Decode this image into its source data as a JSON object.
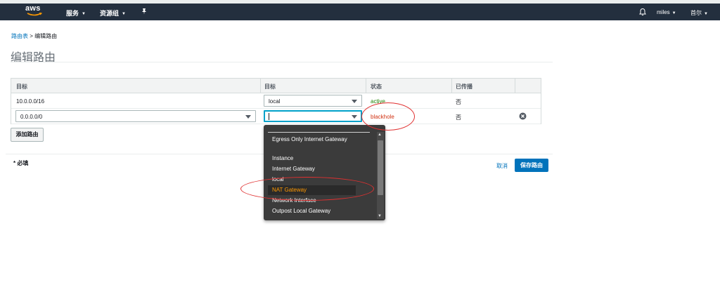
{
  "navbar": {
    "logo_text": "aws",
    "services_label": "服务",
    "resource_groups_label": "资源组",
    "user_label": "miles",
    "region_label": "首尔"
  },
  "breadcrumb": {
    "parent": "路由表",
    "separator": " > ",
    "current": "编辑路由"
  },
  "page_title": "编辑路由",
  "table": {
    "headers": [
      "目标",
      "目标",
      "状态",
      "已传播"
    ],
    "rows": [
      {
        "destination": "10.0.0.0/16",
        "target": "local",
        "status": "active",
        "propagated": "否"
      },
      {
        "destination": "0.0.0.0/0",
        "target": "",
        "status": "blackhole",
        "propagated": "否"
      }
    ]
  },
  "add_route_label": "添加路由",
  "required_note": "* 必填",
  "cancel_label": "取消",
  "save_label": "保存路由",
  "dropdown": {
    "items": [
      "Egress Only Internet Gateway",
      "Instance",
      "Internet Gateway",
      "local",
      "NAT Gateway",
      "Network Interface",
      "Outpost Local Gateway"
    ],
    "highlighted": "NAT Gateway"
  },
  "colors": {
    "navbar_bg": "#232f3e",
    "link": "#0073bb",
    "primary_button": "#0073bb",
    "status_active": "#1d8102",
    "status_blackhole": "#d13212",
    "dropdown_bg": "#3b3b3b",
    "dropdown_highlight": "#ff9900",
    "annotation": "#e03030"
  }
}
